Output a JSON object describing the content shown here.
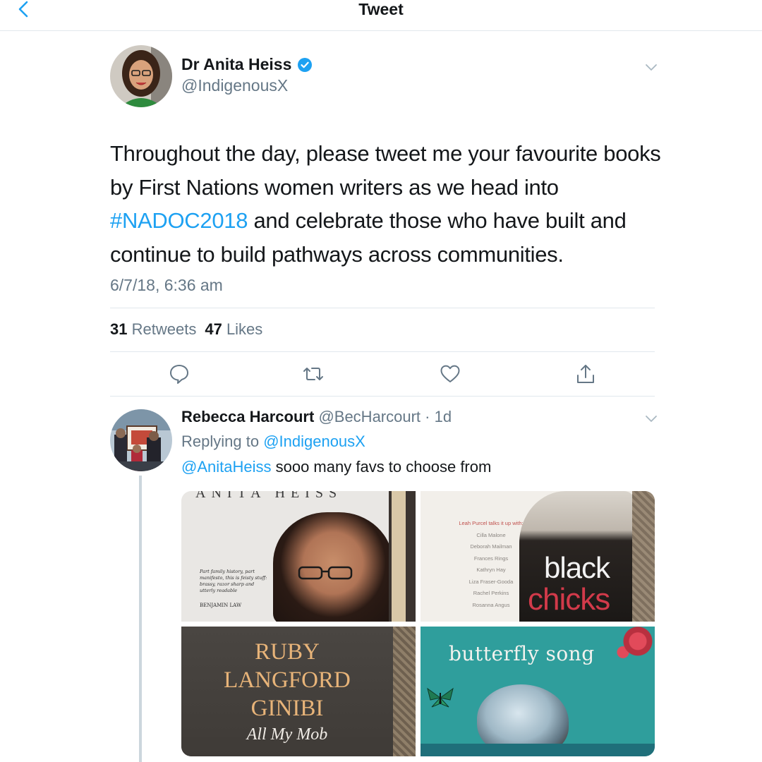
{
  "header": {
    "title": "Tweet"
  },
  "tweet": {
    "author_name": "Dr Anita Heiss",
    "author_handle": "@IndigenousX",
    "text_part1": "Throughout the day, please tweet me your favourite books by First Nations women writers as we head into ",
    "hashtag": "#NADOC2018",
    "text_part2": " and celebrate those who have built and continue to build pathways across communities.",
    "timestamp": "6/7/18, 6:36 am",
    "retweets_count": "31",
    "retweets_label": "Retweets",
    "likes_count": "47",
    "likes_label": "Likes"
  },
  "reply": {
    "author_name": "Rebecca Harcourt",
    "author_meta": "@BecHarcourt · 1d",
    "replying_prefix": "Replying to ",
    "replying_to": "@IndigenousX",
    "mention": "@AnitaHeiss",
    "text": " sooo many favs to choose from"
  },
  "media": {
    "book1": {
      "top_title": "ANITA HEISS",
      "quote": "Part family history, part manifesto, this is feisty stuff: brassy, razor sharp and utterly readable",
      "quote_author": "BENJAMIN LAW"
    },
    "book2": {
      "intro": "Leah Purcel talks it up with:",
      "names": [
        "Cilla Malone",
        "Deborah Mailman",
        "Frances Rings",
        "Kathryn Hay",
        "Liza Fraser-Gooda",
        "Rachel Perkins",
        "Rosanna Angus"
      ],
      "title_line1": "black",
      "title_line2": "chicks"
    },
    "book3": {
      "line1": "RUBY",
      "line2": "LANGFORD",
      "line3": "GINIBI",
      "subtitle": "All My Mob"
    },
    "book4": {
      "title": "butterfly song"
    }
  },
  "colors": {
    "link": "#1da1f2",
    "secondary_text": "#657786",
    "divider": "#e1e8ed",
    "verified": "#1da1f2"
  },
  "icons": [
    "back-chevron-icon",
    "verified-badge-icon",
    "chevron-down-icon",
    "reply-icon",
    "retweet-icon",
    "like-icon",
    "share-icon"
  ]
}
